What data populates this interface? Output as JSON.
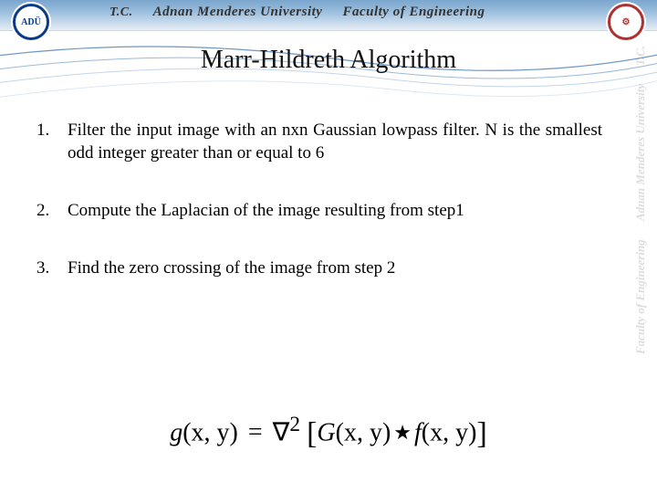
{
  "header": {
    "tc": "T.C.",
    "university": "Adnan Menderes University",
    "faculty": "Faculty of Engineering"
  },
  "title": "Marr-Hildreth Algorithm",
  "steps": [
    {
      "num": "1.",
      "text": "Filter the input image with an nxn Gaussian lowpass filter. N is the smallest odd integer greater than or equal to 6"
    },
    {
      "num": "2.",
      "text": "Compute the Laplacian of the image resulting from step1"
    },
    {
      "num": "3.",
      "text": "Find the zero crossing of the image from step 2"
    }
  ],
  "formula": {
    "lhs_g": "g",
    "xy1": "(x, y)",
    "eq": "=",
    "nabla": "∇",
    "sq": "2",
    "lbr": "[",
    "G": "G",
    "xy2": "(x, y)",
    "star": "★",
    "f": "f",
    "xy3": "(x, y)",
    "rbr": "]"
  },
  "side": {
    "tc": "T.C.",
    "university": "Adnan Menderes University",
    "faculty": "Faculty of Engineering"
  }
}
